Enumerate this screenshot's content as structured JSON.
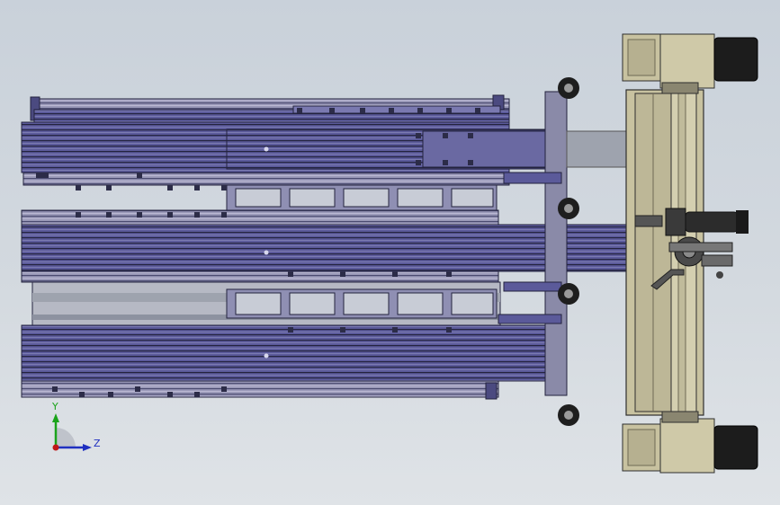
{
  "triad": {
    "y_label": "Y",
    "z_label": "Z",
    "y_color": "#1aa31a",
    "z_color": "#1f2fc0",
    "x_color": "#c01818"
  },
  "colors": {
    "frame_purple": "#5b5a9a",
    "frame_dark": "#23233e",
    "frame_light": "#9d9cc8",
    "carriage_beige": "#c8c2a0",
    "motor_black": "#1c1c1c",
    "plate_grey": "#9ea3ae"
  }
}
